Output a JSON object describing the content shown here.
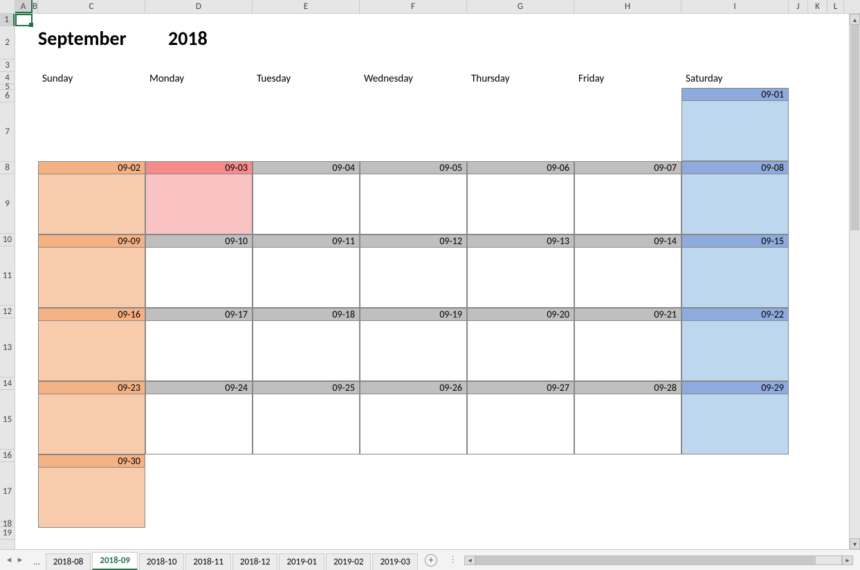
{
  "columns": [
    "A",
    "B",
    "C",
    "D",
    "E",
    "F",
    "G",
    "H",
    "I",
    "J",
    "K",
    "L"
  ],
  "rows": [
    "1",
    "2",
    "3",
    "4",
    "5",
    "6",
    "7",
    "8",
    "9",
    "10",
    "11",
    "12",
    "13",
    "14",
    "15",
    "16",
    "17",
    "18",
    "19"
  ],
  "title": {
    "month": "September",
    "year": "2018"
  },
  "days_of_week": [
    "Sunday",
    "Monday",
    "Tuesday",
    "Wednesday",
    "Thursday",
    "Friday",
    "Saturday"
  ],
  "weeks": [
    [
      null,
      null,
      null,
      null,
      null,
      null,
      {
        "d": "09-01",
        "t": "sat"
      }
    ],
    [
      {
        "d": "09-02",
        "t": "sun"
      },
      {
        "d": "09-03",
        "t": "hol"
      },
      {
        "d": "09-04",
        "t": "wk"
      },
      {
        "d": "09-05",
        "t": "wk"
      },
      {
        "d": "09-06",
        "t": "wk"
      },
      {
        "d": "09-07",
        "t": "wk"
      },
      {
        "d": "09-08",
        "t": "sat"
      }
    ],
    [
      {
        "d": "09-09",
        "t": "sun"
      },
      {
        "d": "09-10",
        "t": "wk"
      },
      {
        "d": "09-11",
        "t": "wk"
      },
      {
        "d": "09-12",
        "t": "wk"
      },
      {
        "d": "09-13",
        "t": "wk"
      },
      {
        "d": "09-14",
        "t": "wk"
      },
      {
        "d": "09-15",
        "t": "sat"
      }
    ],
    [
      {
        "d": "09-16",
        "t": "sun"
      },
      {
        "d": "09-17",
        "t": "wk"
      },
      {
        "d": "09-18",
        "t": "wk"
      },
      {
        "d": "09-19",
        "t": "wk"
      },
      {
        "d": "09-20",
        "t": "wk"
      },
      {
        "d": "09-21",
        "t": "wk"
      },
      {
        "d": "09-22",
        "t": "sat"
      }
    ],
    [
      {
        "d": "09-23",
        "t": "sun"
      },
      {
        "d": "09-24",
        "t": "wk"
      },
      {
        "d": "09-25",
        "t": "wk"
      },
      {
        "d": "09-26",
        "t": "wk"
      },
      {
        "d": "09-27",
        "t": "wk"
      },
      {
        "d": "09-28",
        "t": "wk"
      },
      {
        "d": "09-29",
        "t": "sat"
      }
    ],
    [
      {
        "d": "09-30",
        "t": "sun"
      },
      null,
      null,
      null,
      null,
      null,
      null
    ]
  ],
  "sheet_tabs": {
    "ellipsis": "...",
    "items": [
      "2018-08",
      "2018-09",
      "2018-10",
      "2018-11",
      "2018-12",
      "2019-01",
      "2019-02",
      "2019-03"
    ],
    "active_index": 1,
    "add_label": "+"
  },
  "selected_cell": "A1"
}
